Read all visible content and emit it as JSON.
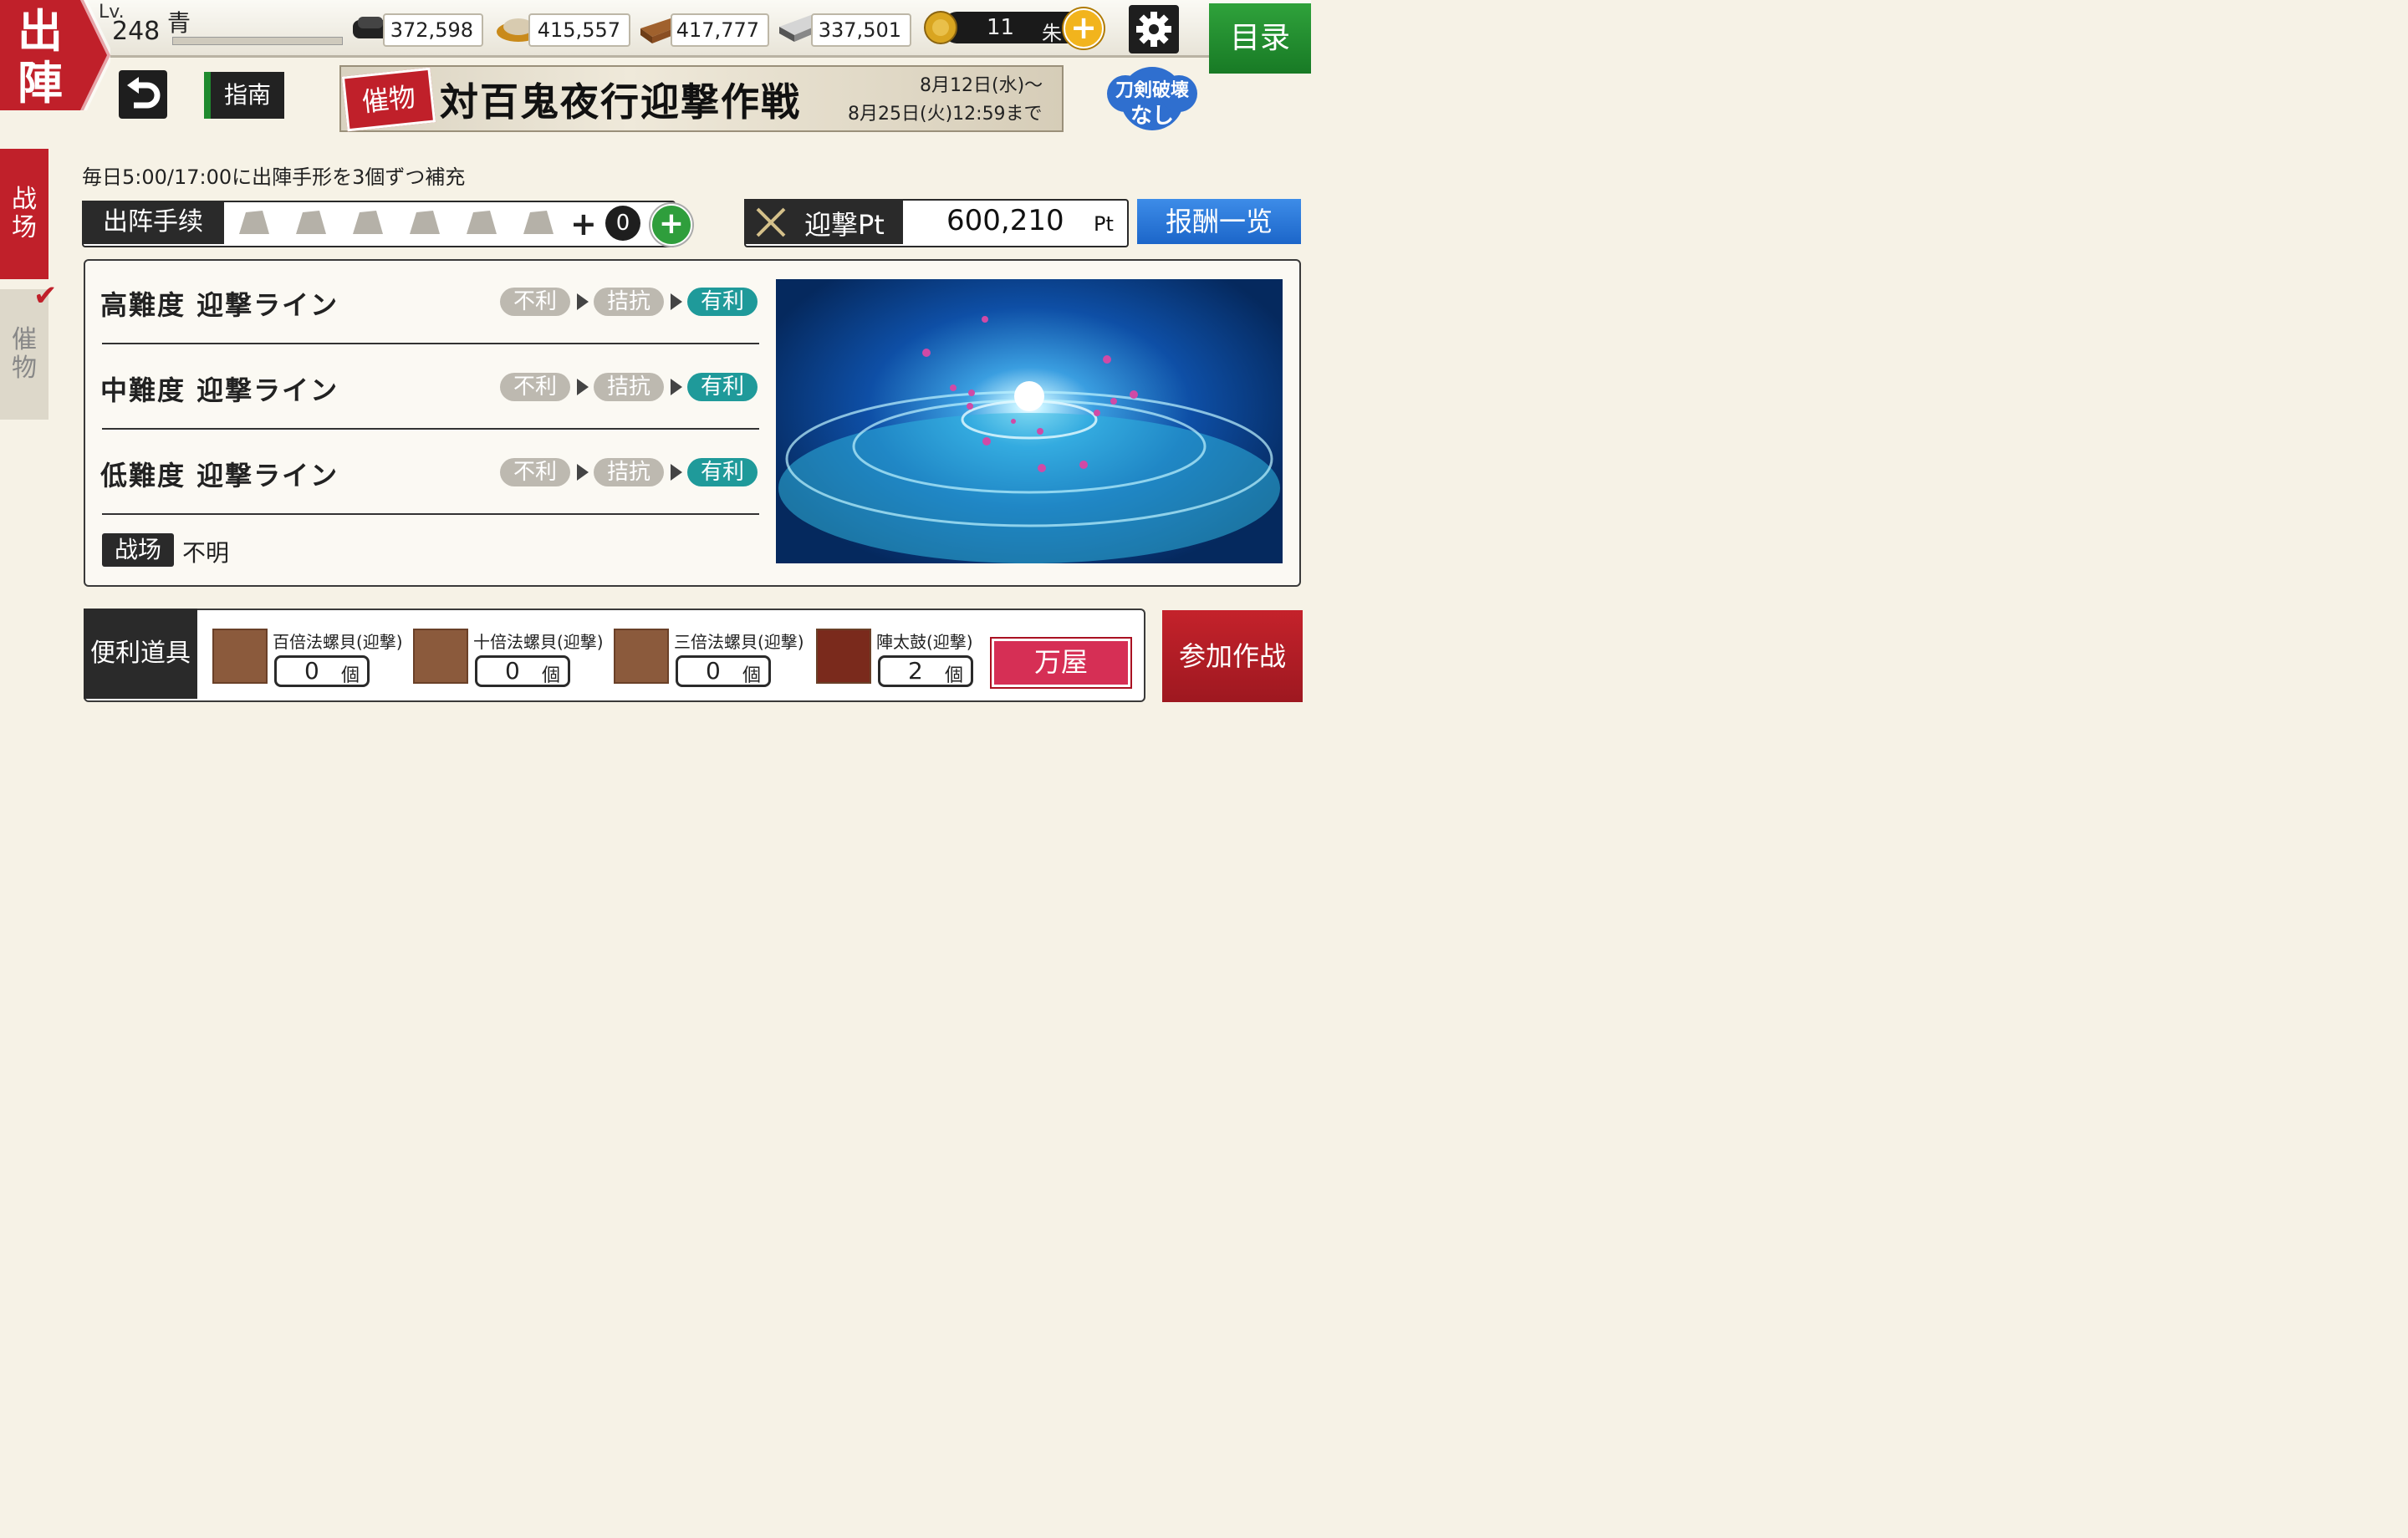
{
  "page": {
    "title": "出陣"
  },
  "player": {
    "lv_label": "Lv.",
    "level": "248",
    "name": "青"
  },
  "resources": [
    {
      "icon": "charcoal-icon",
      "value": "372,598"
    },
    {
      "icon": "whetstone-icon",
      "value": "415,557"
    },
    {
      "icon": "cooling-material-icon",
      "value": "417,777"
    },
    {
      "icon": "steel-icon",
      "value": "337,501"
    }
  ],
  "coins": {
    "value": "11",
    "unit": "朱"
  },
  "nav": {
    "menu": "目录",
    "guide": "指南"
  },
  "banner": {
    "tag": "催物",
    "title": "対百鬼夜行迎撃作戦",
    "date_start": "8月12日(水)～",
    "date_end": "8月25日(火)12:59まで"
  },
  "no_break": {
    "line1": "刀剣破壊",
    "line2": "なし"
  },
  "side_tabs": [
    {
      "label": "战场"
    },
    {
      "label": "催物"
    }
  ],
  "info": {
    "refill": "毎日5:00/17:00に出陣手形を3個ずつ補充"
  },
  "ticket": {
    "label": "出阵手续",
    "plus": "+",
    "count": "0"
  },
  "points": {
    "label": "迎撃Pt",
    "value": "600,210",
    "unit": "Pt",
    "reward_button": "报酬一览"
  },
  "lines": [
    {
      "title": "高難度 迎撃ライン",
      "states": [
        "不利",
        "拮抗",
        "有利"
      ],
      "active": 2
    },
    {
      "title": "中難度 迎撃ライン",
      "states": [
        "不利",
        "拮抗",
        "有利"
      ],
      "active": 2
    },
    {
      "title": "低難度 迎撃ライン",
      "states": [
        "不利",
        "拮抗",
        "有利"
      ],
      "active": 2
    }
  ],
  "battlefield": {
    "label": "战场",
    "value": "不明"
  },
  "tools": {
    "label": "便利道具",
    "unit": "個",
    "items": [
      {
        "name": "百倍法螺貝(迎撃)",
        "count": "0"
      },
      {
        "name": "十倍法螺貝(迎撃)",
        "count": "0"
      },
      {
        "name": "三倍法螺貝(迎撃)",
        "count": "0"
      },
      {
        "name": "陣太鼓(迎撃)",
        "count": "2"
      }
    ]
  },
  "shop": {
    "label": "万屋"
  },
  "join": {
    "label": "参加作战"
  },
  "colors": {
    "accent_red": "#c0202a",
    "accent_green": "#2f9e3c",
    "accent_blue": "#1c66c9",
    "state_active": "#1f9a9a",
    "state_inactive": "#bdb9b0"
  }
}
